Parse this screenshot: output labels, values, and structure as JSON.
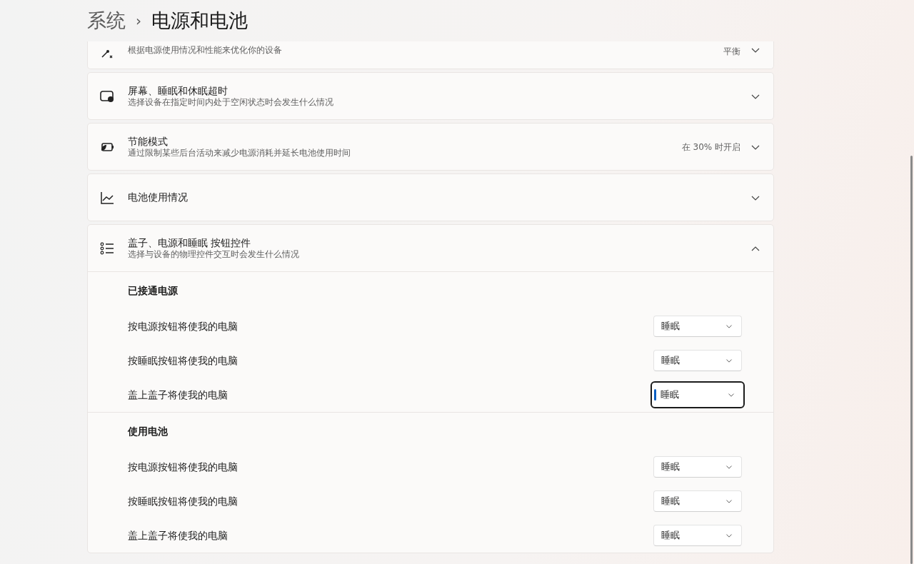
{
  "breadcrumb": {
    "parent": "系统",
    "separator": "›",
    "current": "电源和电池"
  },
  "settings": [
    {
      "description": "根据电源使用情况和性能来优化你的设备",
      "value": "平衡",
      "expanded": false
    },
    {
      "title": "屏幕、睡眠和休眠超时",
      "description": "选择设备在指定时间内处于空闲状态时会发生什么情况",
      "expanded": false
    },
    {
      "title": "节能模式",
      "description": "通过限制某些后台活动来减少电源消耗并延长电池使用时间",
      "value": "在 30% 时开启",
      "expanded": false
    },
    {
      "title": "电池使用情况",
      "expanded": false
    },
    {
      "title": "盖子、电源和睡眠 按钮控件",
      "description": "选择与设备的物理控件交互时会发生什么情况",
      "expanded": true,
      "groups": [
        {
          "heading": "已接通电源",
          "rows": [
            {
              "label": "按电源按钮将使我的电脑",
              "value": "睡眠",
              "focused": false
            },
            {
              "label": "按睡眠按钮将使我的电脑",
              "value": "睡眠",
              "focused": false
            },
            {
              "label": "盖上盖子将使我的电脑",
              "value": "睡眠",
              "focused": true
            }
          ]
        },
        {
          "heading": "使用电池",
          "rows": [
            {
              "label": "按电源按钮将使我的电脑",
              "value": "睡眠",
              "focused": false
            },
            {
              "label": "按睡眠按钮将使我的电脑",
              "value": "睡眠",
              "focused": false
            },
            {
              "label": "盖上盖子将使我的电脑",
              "value": "睡眠",
              "focused": false
            }
          ]
        }
      ]
    }
  ]
}
